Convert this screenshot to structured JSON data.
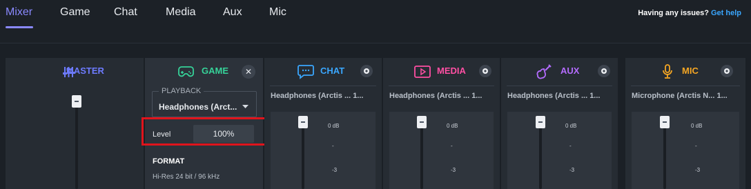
{
  "nav": {
    "tabs": [
      {
        "label": "Mixer",
        "active": true
      },
      {
        "label": "Game",
        "active": false
      },
      {
        "label": "Chat",
        "active": false
      },
      {
        "label": "Media",
        "active": false
      },
      {
        "label": "Aux",
        "active": false
      },
      {
        "label": "Mic",
        "active": false
      }
    ],
    "help_question": "Having any issues?",
    "help_link": "Get help"
  },
  "colors": {
    "accent": "#8a89ff",
    "master": "#6d7bff",
    "game": "#36d399",
    "chat": "#3aa7ff",
    "media": "#ff4fa3",
    "aux": "#b46cff",
    "mic": "#f5a623",
    "highlight": "#e0141c"
  },
  "channels": {
    "master": {
      "title": "MASTER",
      "icon": "mixer-sliders-icon"
    },
    "game": {
      "title": "GAME",
      "icon": "gamepad-icon",
      "playback_label": "PLAYBACK",
      "playback_device": "Headphones (Arct...",
      "level_label": "Level",
      "level_value": "100%",
      "format_heading": "FORMAT",
      "format_value": "Hi-Res 24 bit / 96 kHz"
    },
    "chat": {
      "title": "CHAT",
      "icon": "chat-bubble-icon",
      "device": "Headphones (Arctis ...  1...",
      "db_top": "0 dB",
      "db_mid": "-",
      "db_low": "-3"
    },
    "media": {
      "title": "MEDIA",
      "icon": "play-icon",
      "device": "Headphones (Arctis ...  1...",
      "db_top": "0 dB",
      "db_mid": "-",
      "db_low": "-3"
    },
    "aux": {
      "title": "AUX",
      "icon": "guitar-icon",
      "device": "Headphones (Arctis ...  1...",
      "db_top": "0 dB",
      "db_mid": "-",
      "db_low": "-3"
    },
    "mic": {
      "title": "MIC",
      "icon": "microphone-icon",
      "device": "Microphone (Arctis N... 1...",
      "db_top": "0 dB",
      "db_mid": "-",
      "db_low": "-3"
    }
  }
}
